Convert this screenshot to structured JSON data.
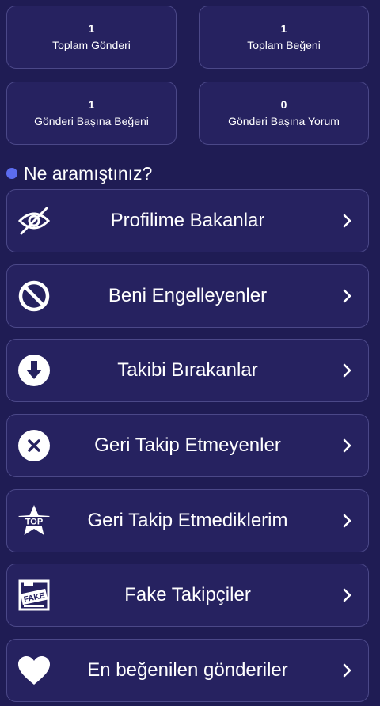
{
  "stats": [
    {
      "value": "1",
      "label": "Toplam Gönderi"
    },
    {
      "value": "1",
      "label": "Toplam Beğeni"
    },
    {
      "value": "1",
      "label": "Gönderi Başına Beğeni"
    },
    {
      "value": "0",
      "label": "Gönderi Başına Yorum"
    }
  ],
  "section": {
    "title": "Ne aramıştınız?"
  },
  "menu": [
    {
      "label": "Profilime Bakanlar",
      "icon": "eye-slash-icon"
    },
    {
      "label": "Beni Engelleyenler",
      "icon": "ban-icon"
    },
    {
      "label": "Takibi Bırakanlar",
      "icon": "arrow-down-circle-icon"
    },
    {
      "label": "Geri Takip Etmeyenler",
      "icon": "x-circle-icon"
    },
    {
      "label": "Geri Takip Etmediklerim",
      "icon": "top-star-icon"
    },
    {
      "label": "Fake Takipçiler",
      "icon": "fake-stamp-icon"
    },
    {
      "label": "En beğenilen gönderiler",
      "icon": "heart-icon"
    }
  ],
  "icon_texts": {
    "top": "TOP",
    "fake": "FAKE"
  },
  "colors": {
    "background": "#1f1c54",
    "card": "#262260",
    "border": "#4b4888",
    "dot": "#5c6cf0"
  }
}
